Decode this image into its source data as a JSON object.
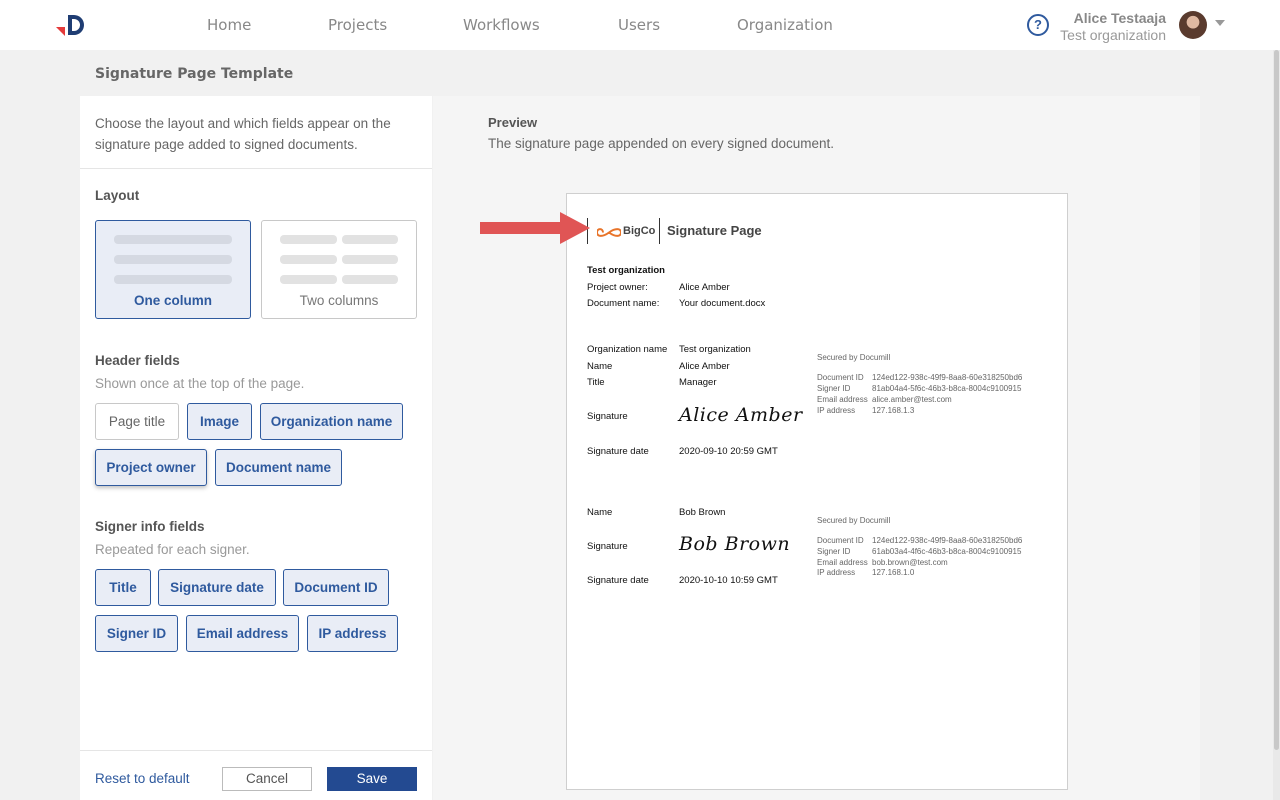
{
  "nav": {
    "items": [
      "Home",
      "Projects",
      "Workflows",
      "Users",
      "Organization"
    ],
    "help_glyph": "?",
    "user_name": "Alice Testaaja",
    "user_org": "Test organization",
    "accent": "#2f5a9e"
  },
  "page_title": "Signature Page Template",
  "left": {
    "intro": "Choose the layout and which fields appear on the signature page added to signed documents.",
    "layout": {
      "title": "Layout",
      "options": [
        {
          "label": "One column",
          "selected": true
        },
        {
          "label": "Two columns",
          "selected": false
        }
      ]
    },
    "header_fields": {
      "title": "Header fields",
      "subtitle": "Shown once at the top of the page.",
      "chips": [
        {
          "label": "Page title",
          "active": false
        },
        {
          "label": "Image",
          "active": true
        },
        {
          "label": "Organization name",
          "active": true
        },
        {
          "label": "Project owner",
          "active": true
        },
        {
          "label": "Document name",
          "active": true
        }
      ]
    },
    "signer_fields": {
      "title": "Signer info fields",
      "subtitle": "Repeated for each signer.",
      "chips": [
        {
          "label": "Title",
          "active": true
        },
        {
          "label": "Signature date",
          "active": true
        },
        {
          "label": "Document ID",
          "active": true
        },
        {
          "label": "Signer ID",
          "active": true
        },
        {
          "label": "Email address",
          "active": true
        },
        {
          "label": "IP address",
          "active": true
        }
      ]
    },
    "footer": {
      "reset": "Reset to default",
      "cancel": "Cancel",
      "save": "Save"
    }
  },
  "preview": {
    "title": "Preview",
    "subtitle": "The signature page appended on every signed document.",
    "doc": {
      "brand": "BigCo",
      "page_title": "Signature Page",
      "org": "Test organization",
      "project_owner_label": "Project owner:",
      "project_owner": "Alice Amber",
      "document_name_label": "Document name:",
      "document_name": "Your document.docx",
      "signers": [
        {
          "rows": [
            {
              "label": "Organization name",
              "value": "Test organization"
            },
            {
              "label": "Name",
              "value": "Alice Amber"
            },
            {
              "label": "Title",
              "value": "Manager"
            }
          ],
          "signature_label": "Signature",
          "signature": "Alice Amber",
          "date_label": "Signature date",
          "date": "2020-09-10 20:59 GMT",
          "secured": "Secured by Documill",
          "meta": [
            {
              "label": "Document ID",
              "value": "124ed122-938c-49f9-8aa8-60e318250bd6"
            },
            {
              "label": "Signer ID",
              "value": "81ab04a4-5f6c-46b3-b8ca-8004c9100915"
            },
            {
              "label": "Email address",
              "value": "alice.amber@test.com"
            },
            {
              "label": "IP address",
              "value": "127.168.1.3"
            }
          ]
        },
        {
          "rows": [
            {
              "label": "Name",
              "value": "Bob Brown"
            }
          ],
          "signature_label": "Signature",
          "signature": "Bob Brown",
          "date_label": "Signature date",
          "date": "2020-10-10 10:59 GMT",
          "secured": "Secured by Documill",
          "meta": [
            {
              "label": "Document ID",
              "value": "124ed122-938c-49f9-8aa8-60e318250bd6"
            },
            {
              "label": "Signer ID",
              "value": "61ab03a4-4f6c-46b3-b8ca-8004c9100915"
            },
            {
              "label": "Email address",
              "value": "bob.brown@test.com"
            },
            {
              "label": "IP address",
              "value": "127.168.1.0"
            }
          ]
        }
      ]
    }
  }
}
